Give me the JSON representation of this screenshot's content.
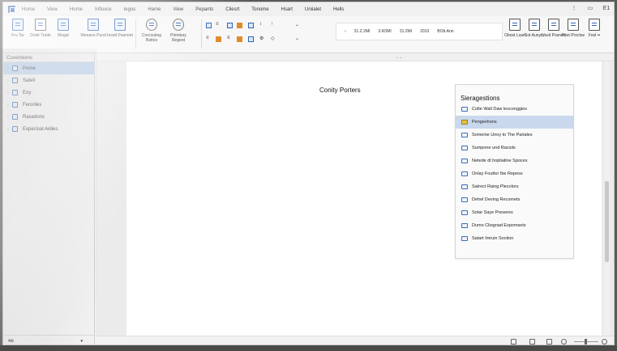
{
  "menu": [
    "Home",
    "View",
    "Home",
    "Infiuxce",
    "Iegos",
    "Hame",
    "View",
    "Pepants",
    "Cliesrt",
    "Tonome",
    "Hsart",
    "Uniialet",
    "Hells"
  ],
  "window_controls": [
    "⋮",
    "▭",
    "E1"
  ],
  "ribbon": {
    "buttons": [
      {
        "label": "Fru Tar"
      },
      {
        "label": "Dosit Trade"
      },
      {
        "label": "Megat"
      },
      {
        "label": "Weeane Pund"
      },
      {
        "label": "Insstt Pasnont"
      },
      {
        "label": "Crecouting Battos"
      },
      {
        "label": "Pinmtury Regeot"
      }
    ],
    "right_buttons": [
      {
        "label": "Obost Lsart"
      },
      {
        "label": "Sot Aunyin"
      },
      {
        "label": "Ussit Posnert"
      },
      {
        "label": "Pest Proctse"
      },
      {
        "label": "Fool ••"
      }
    ],
    "status_values": [
      "31.Z.2MI",
      "3.6OMI",
      "31.2MI",
      "2010",
      "BOtt.Ann"
    ]
  },
  "sidebar": {
    "header": "Cuventeens",
    "items": [
      {
        "label": "Pome",
        "active": true
      },
      {
        "label": "Satell",
        "active": false
      },
      {
        "label": "Eoy",
        "active": false
      },
      {
        "label": "Feroriles",
        "active": false
      },
      {
        "label": "Rasedons",
        "active": false
      },
      {
        "label": "Expecisal Aidies",
        "active": false
      }
    ],
    "footer": "4di"
  },
  "document": {
    "title": "Conity Porters"
  },
  "suggestions": {
    "title": "Sieragestions",
    "items": [
      {
        "label": "Colte Wall Daw lesconggies",
        "active": false
      },
      {
        "label": "Pengeshons",
        "active": true
      },
      {
        "label": "Someine Unoy to The Pariales",
        "active": false
      },
      {
        "label": "Sumpone und Raciols",
        "active": false
      },
      {
        "label": "Netede dl hopliatine Spoces",
        "active": false
      },
      {
        "label": "Onlay Fouttor Ibe Repess",
        "active": false
      },
      {
        "label": "Satrect Raing Plecolors",
        "active": false
      },
      {
        "label": "Dehel Deving Recomets",
        "active": false
      },
      {
        "label": "Sotar Saye Preseres",
        "active": false
      },
      {
        "label": "Dumo Cliognad Expomsets",
        "active": false
      },
      {
        "label": "Satart Imruin Soction",
        "active": false
      }
    ]
  },
  "colors": {
    "accent": "#2f62b5",
    "selection": "#b9d1ee"
  }
}
